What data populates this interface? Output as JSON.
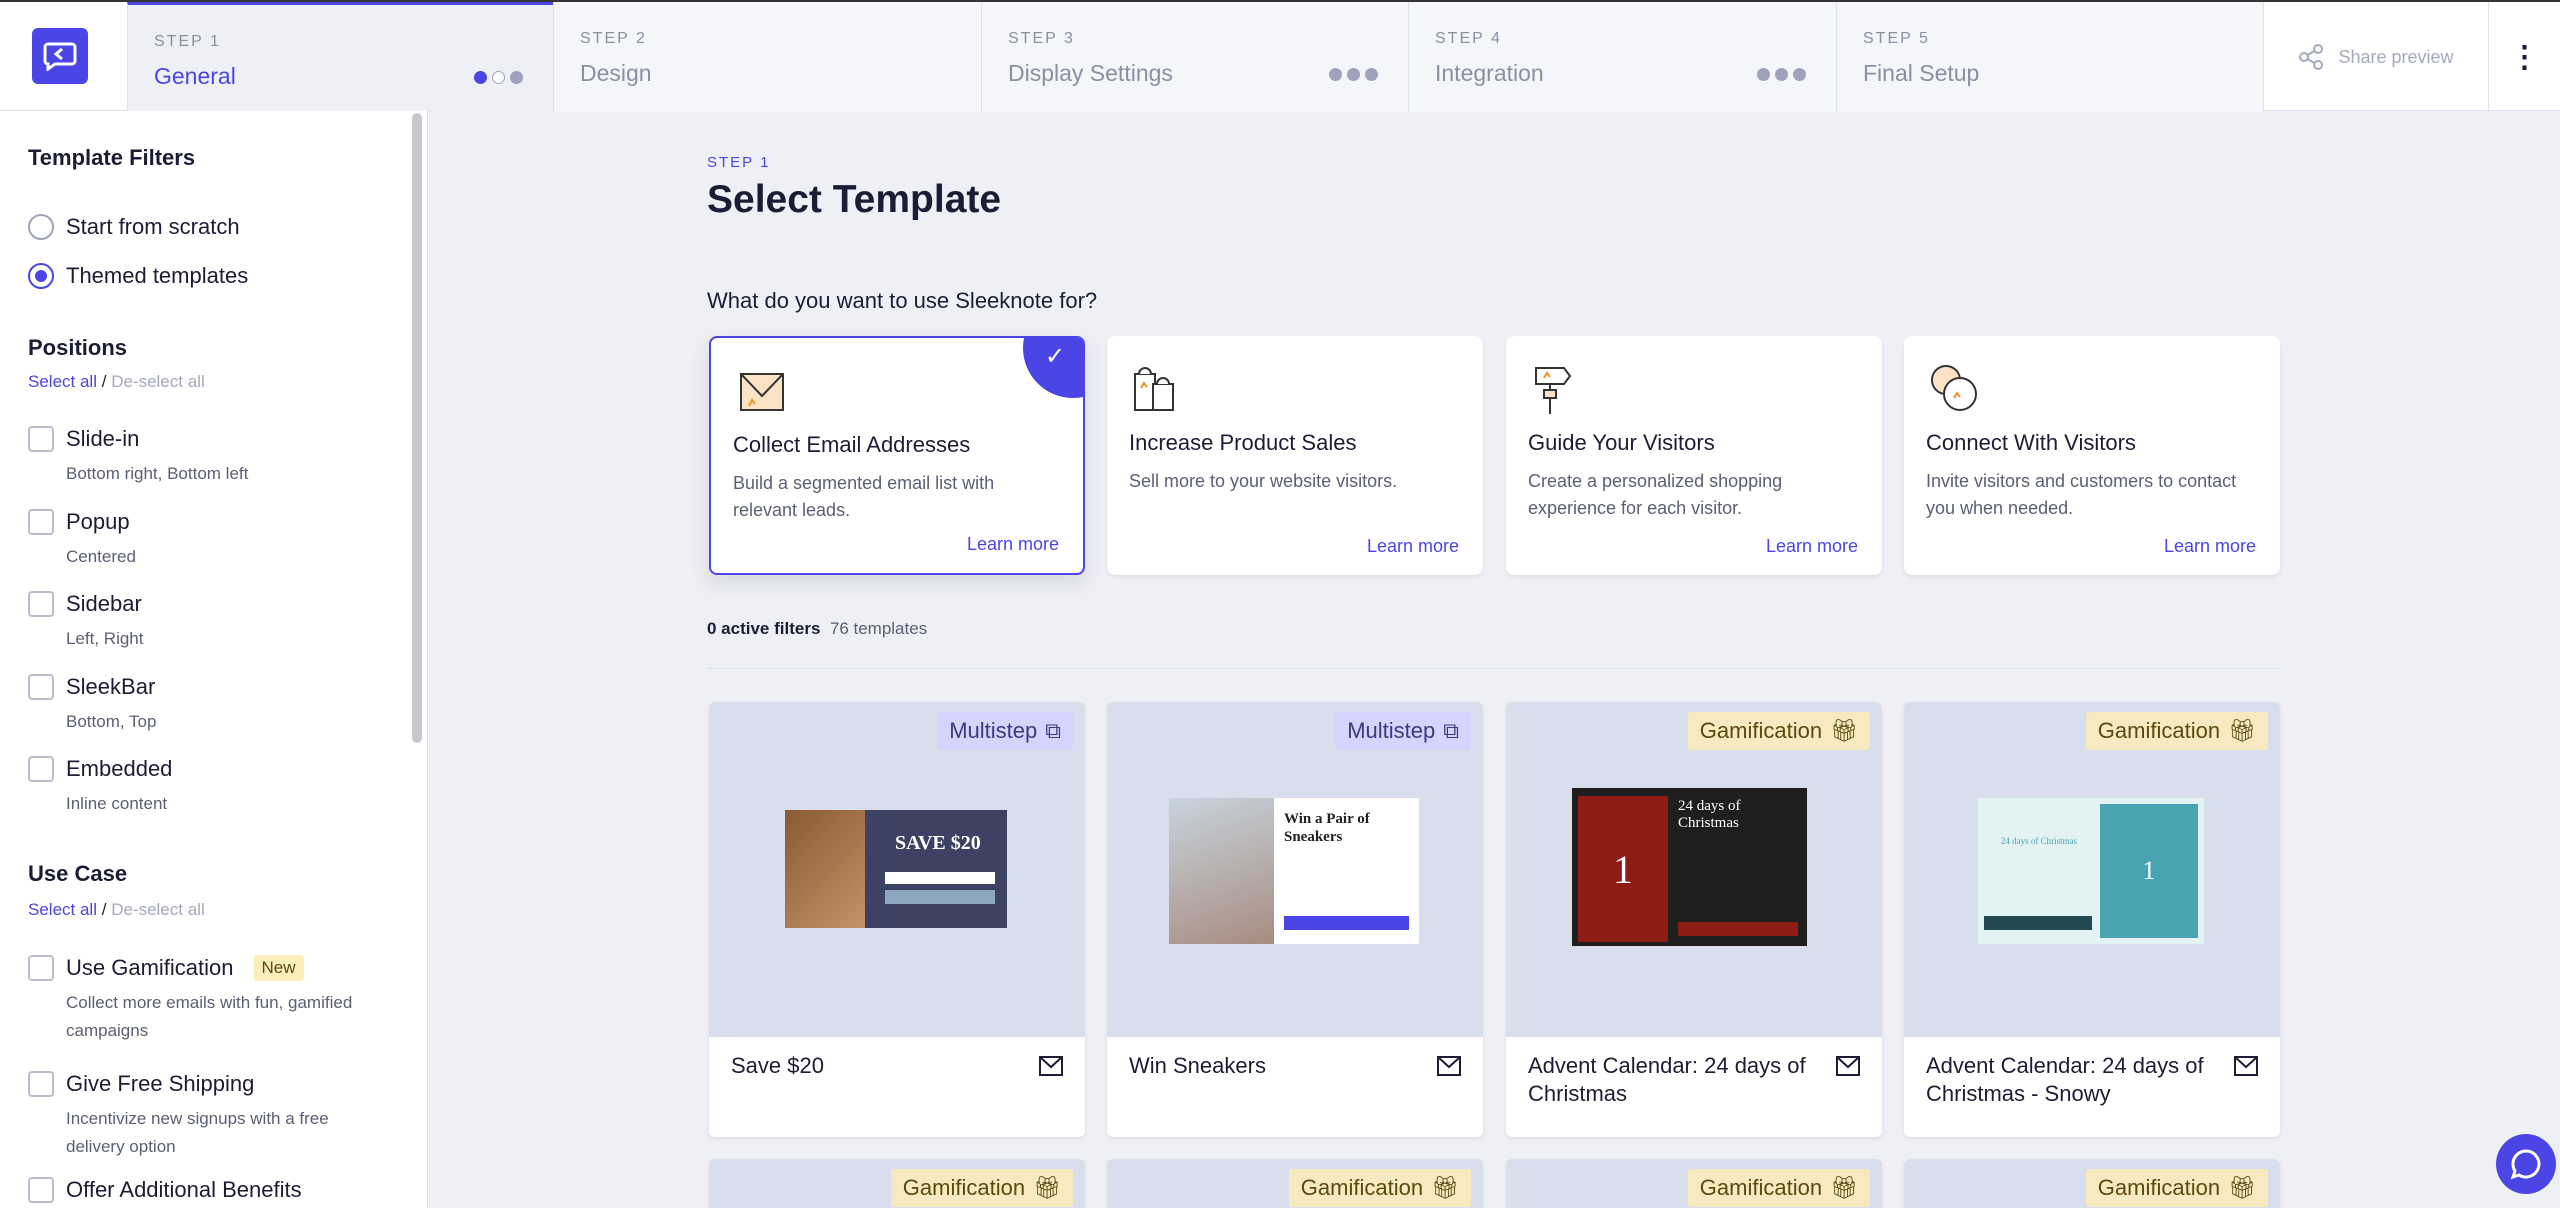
{
  "header": {
    "steps": [
      {
        "label": "STEP 1",
        "name": "General",
        "dots": [
          "filled",
          "empty",
          "grey"
        ],
        "active": true
      },
      {
        "label": "STEP 2",
        "name": "Design"
      },
      {
        "label": "STEP 3",
        "name": "Display Settings",
        "dots": [
          "grey",
          "grey",
          "grey"
        ]
      },
      {
        "label": "STEP 4",
        "name": "Integration",
        "dots": [
          "grey",
          "grey",
          "grey"
        ]
      },
      {
        "label": "STEP 5",
        "name": "Final Setup"
      }
    ],
    "share": "Share preview"
  },
  "sidebar": {
    "title": "Template Filters",
    "radios": [
      {
        "label": "Start from scratch",
        "checked": false
      },
      {
        "label": "Themed templates",
        "checked": true
      }
    ],
    "positions": {
      "title": "Positions",
      "select_all": "Select all",
      "sep": "/",
      "deselect_all": "De-select all",
      "items": [
        {
          "label": "Slide-in",
          "sub": "Bottom right, Bottom left"
        },
        {
          "label": "Popup",
          "sub": "Centered"
        },
        {
          "label": "Sidebar",
          "sub": "Left, Right"
        },
        {
          "label": "SleekBar",
          "sub": "Bottom, Top"
        },
        {
          "label": "Embedded",
          "sub": "Inline content"
        }
      ]
    },
    "use_case": {
      "title": "Use Case",
      "select_all": "Select all",
      "sep": "/",
      "deselect_all": "De-select all",
      "items": [
        {
          "label": "Use Gamification",
          "badge": "New",
          "sub": "Collect more emails with fun, gamified campaigns"
        },
        {
          "label": "Give Free Shipping",
          "sub": "Incentivize new signups with a free delivery option"
        },
        {
          "label": "Offer Additional Benefits"
        }
      ]
    }
  },
  "main": {
    "step": "STEP 1",
    "title": "Select Template",
    "question": "What do you want to use Sleeknote for?",
    "use_cases": [
      {
        "title": "Collect Email Addresses",
        "desc": "Build a segmented email list with relevant leads.",
        "link": "Learn more",
        "selected": true
      },
      {
        "title": "Increase Product Sales",
        "desc": "Sell more to your website visitors.",
        "link": "Learn more"
      },
      {
        "title": "Guide Your Visitors",
        "desc": "Create a personalized shopping experience for each visitor.",
        "link": "Learn more"
      },
      {
        "title": "Connect With Visitors",
        "desc": "Invite visitors and customers to contact you when needed.",
        "link": "Learn more"
      }
    ],
    "filters": {
      "active": "0 active filters",
      "count": "76 templates"
    },
    "templates": [
      {
        "name": "Save $20",
        "badge": "Multistep",
        "thumb": "SAVE $20"
      },
      {
        "name": "Win Sneakers",
        "badge": "Multistep",
        "thumb": "Win a Pair of Sneakers"
      },
      {
        "name": "Advent Calendar: 24 days of Christmas",
        "badge": "Gamification",
        "thumb": "24 days of Christmas",
        "num": "1"
      },
      {
        "name": "Advent Calendar: 24 days of Christmas - Snowy",
        "badge": "Gamification",
        "thumb": "24 days of Christmas",
        "num": "1"
      }
    ],
    "next_row_badges": [
      "Gamification",
      "Gamification",
      "Gamification",
      "Gamification"
    ]
  },
  "colors": {
    "accent": "#4b45e6",
    "multistep_badge": "#d4d4ff",
    "gamification_badge": "#f8eac0"
  }
}
